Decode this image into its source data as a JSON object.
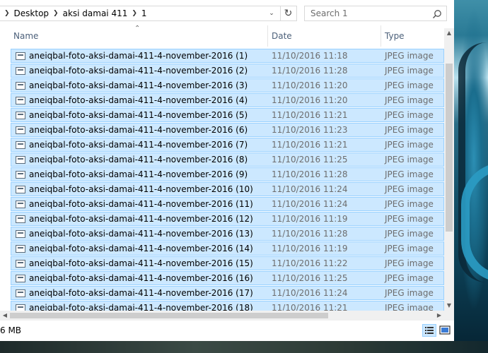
{
  "breadcrumb": {
    "items": [
      "Desktop",
      "aksi damai 411",
      "1"
    ]
  },
  "search": {
    "placeholder": "Search 1"
  },
  "columns": {
    "name": "Name",
    "date": "Date",
    "type": "Type"
  },
  "files": [
    {
      "name": "aneiqbal-foto-aksi-damai-411-4-november-2016 (1)",
      "date": "11/10/2016 11:18",
      "type": "JPEG image"
    },
    {
      "name": "aneiqbal-foto-aksi-damai-411-4-november-2016 (2)",
      "date": "11/10/2016 11:28",
      "type": "JPEG image"
    },
    {
      "name": "aneiqbal-foto-aksi-damai-411-4-november-2016 (3)",
      "date": "11/10/2016 11:20",
      "type": "JPEG image"
    },
    {
      "name": "aneiqbal-foto-aksi-damai-411-4-november-2016 (4)",
      "date": "11/10/2016 11:20",
      "type": "JPEG image"
    },
    {
      "name": "aneiqbal-foto-aksi-damai-411-4-november-2016 (5)",
      "date": "11/10/2016 11:21",
      "type": "JPEG image"
    },
    {
      "name": "aneiqbal-foto-aksi-damai-411-4-november-2016 (6)",
      "date": "11/10/2016 11:23",
      "type": "JPEG image"
    },
    {
      "name": "aneiqbal-foto-aksi-damai-411-4-november-2016 (7)",
      "date": "11/10/2016 11:21",
      "type": "JPEG image"
    },
    {
      "name": "aneiqbal-foto-aksi-damai-411-4-november-2016 (8)",
      "date": "11/10/2016 11:25",
      "type": "JPEG image"
    },
    {
      "name": "aneiqbal-foto-aksi-damai-411-4-november-2016 (9)",
      "date": "11/10/2016 11:28",
      "type": "JPEG image"
    },
    {
      "name": "aneiqbal-foto-aksi-damai-411-4-november-2016 (10)",
      "date": "11/10/2016 11:24",
      "type": "JPEG image"
    },
    {
      "name": "aneiqbal-foto-aksi-damai-411-4-november-2016 (11)",
      "date": "11/10/2016 11:24",
      "type": "JPEG image"
    },
    {
      "name": "aneiqbal-foto-aksi-damai-411-4-november-2016 (12)",
      "date": "11/10/2016 11:19",
      "type": "JPEG image"
    },
    {
      "name": "aneiqbal-foto-aksi-damai-411-4-november-2016 (13)",
      "date": "11/10/2016 11:28",
      "type": "JPEG image"
    },
    {
      "name": "aneiqbal-foto-aksi-damai-411-4-november-2016 (14)",
      "date": "11/10/2016 11:19",
      "type": "JPEG image"
    },
    {
      "name": "aneiqbal-foto-aksi-damai-411-4-november-2016 (15)",
      "date": "11/10/2016 11:22",
      "type": "JPEG image"
    },
    {
      "name": "aneiqbal-foto-aksi-damai-411-4-november-2016 (16)",
      "date": "11/10/2016 11:25",
      "type": "JPEG image"
    },
    {
      "name": "aneiqbal-foto-aksi-damai-411-4-november-2016 (17)",
      "date": "11/10/2016 11:24",
      "type": "JPEG image"
    },
    {
      "name": "aneiqbal-foto-aksi-damai-411-4-november-2016 (18)",
      "date": "11/10/2016 11:21",
      "type": "JPEG image"
    }
  ],
  "status": {
    "size": "6 MB"
  },
  "colors": {
    "selection_bg": "#cce8ff",
    "selection_border": "#99d1ff",
    "header_text": "#4c607a"
  }
}
